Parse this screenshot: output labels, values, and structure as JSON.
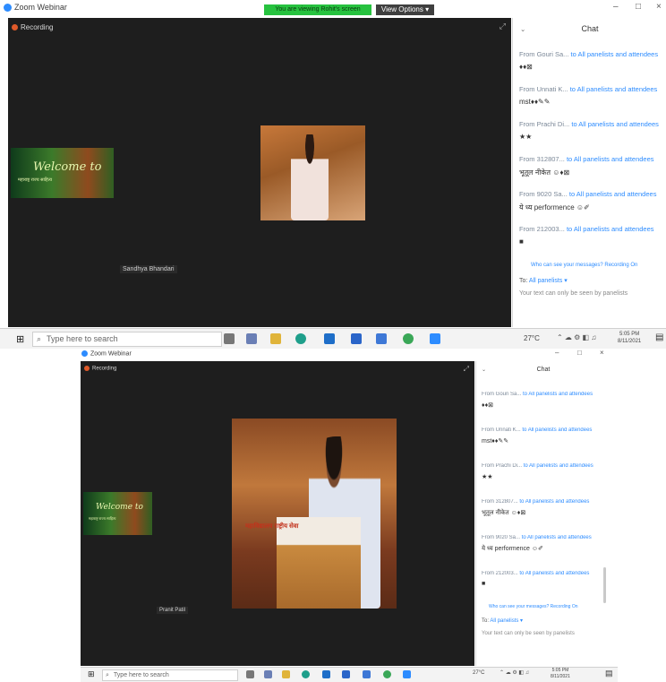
{
  "window": {
    "title": "Zoom Webinar",
    "recording_label": "Recording"
  },
  "share_banner": {
    "text": "You are viewing Rohit's screen",
    "options": "View Options ▾"
  },
  "chat": {
    "title": "Chat",
    "messages": [
      {
        "from": "From Gouri Sa...",
        "to": "to All panelists and attendees",
        "text": "♦♦⊠"
      },
      {
        "from": "From Unnati K...",
        "to": "to All panelists and attendees",
        "text": "mst♦♦✎✎"
      },
      {
        "from": "From Prachi Di...",
        "to": "to All panelists and attendees",
        "text": "★★"
      },
      {
        "from": "From 312807...",
        "to": "to All panelists and attendees",
        "text": "भूतूल नीकेत ☺♦⊠"
      },
      {
        "from": "From 9020 Sa...",
        "to": "to All panelists and attendees",
        "text": "ये ध्य performence ☺✐"
      },
      {
        "from": "From 212003...",
        "to": "to All panelists and attendees",
        "text": "■"
      }
    ],
    "hint": "Who can see your messages? Recording On",
    "to_label": "To:",
    "to_value": "All panelists ▾",
    "footer": "Your text can only be seen by panelists"
  },
  "banner": {
    "welcome": "Welcome to",
    "subtitle": "महाराष्ट्र राज्य साहित्य"
  },
  "participants": {
    "top_name": "Sandhya Bhandari",
    "bottom_name": "Pranit Patil"
  },
  "taskbar": {
    "search_placeholder": "Type here to search",
    "weather": "27°C",
    "time": "5:05 PM",
    "date": "8/11/2021"
  },
  "podium_banner": "महाविद्यालय राष्ट्रीय सेवा"
}
